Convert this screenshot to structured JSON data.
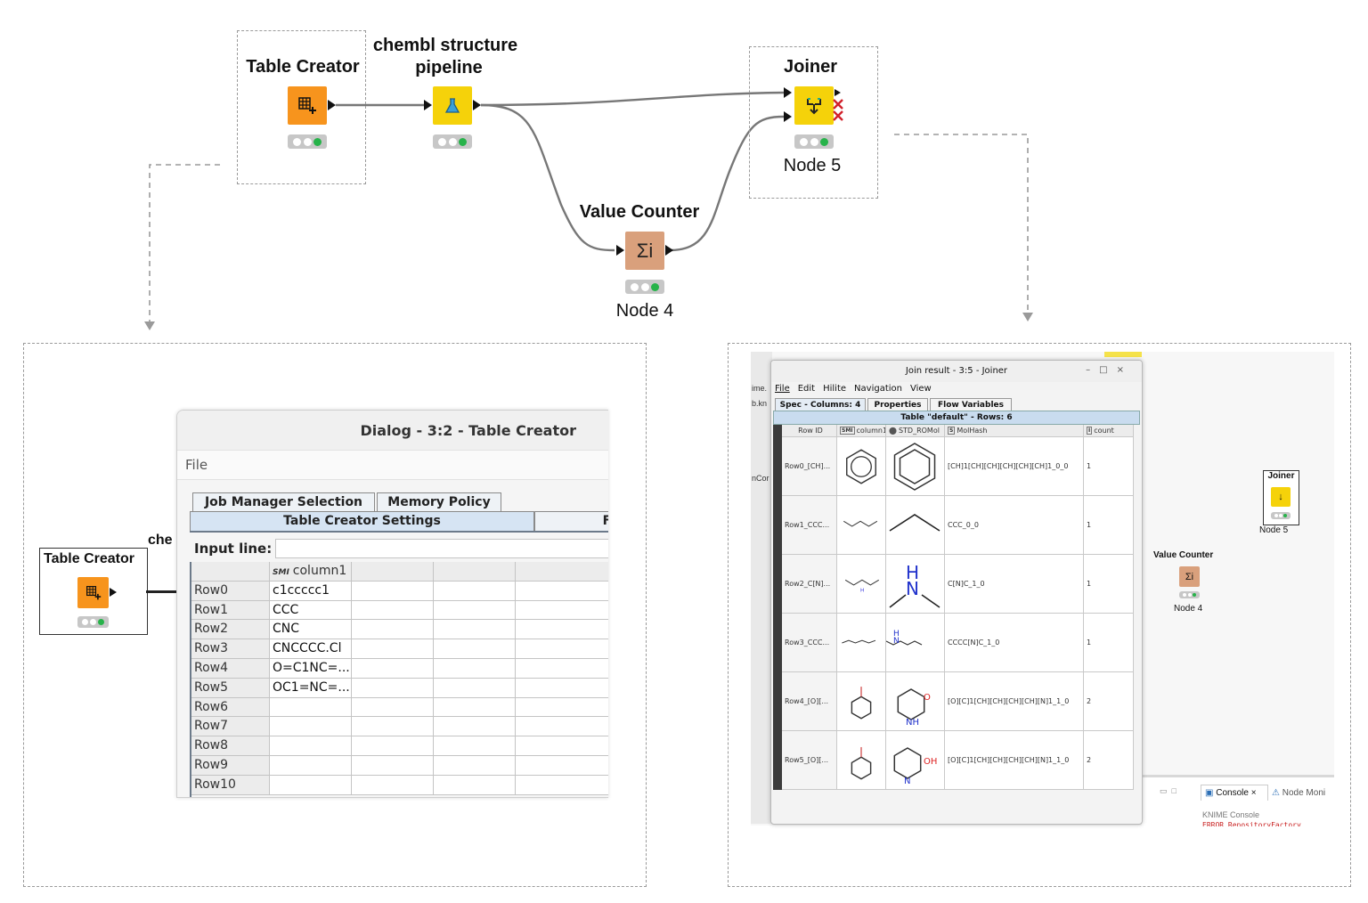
{
  "workflow": {
    "nodes": {
      "table_creator": {
        "title": "Table Creator",
        "icon": "table-plus-icon",
        "color": "#f7941d"
      },
      "chembl": {
        "title_line1": "chembl structure",
        "title_line2": "pipeline",
        "icon": "flask-icon",
        "color": "#f5d20a"
      },
      "joiner": {
        "title": "Joiner",
        "label": "Node 5",
        "icon": "joiner-icon",
        "color": "#f5d20a"
      },
      "value_counter": {
        "title": "Value Counter",
        "label": "Node 4",
        "icon": "sigma-icon",
        "color": "#d9a07c"
      }
    }
  },
  "dialog_panel": {
    "node_title": "Table Creator",
    "partial_label": "che",
    "dialog": {
      "title": "Dialog - 3:2 - Table Creator",
      "menu": "File",
      "tabs": [
        "Job Manager Selection",
        "Memory Policy"
      ],
      "selected_tab": "Table Creator Settings",
      "partial_tab": "Fl",
      "input_label": "Input line:",
      "column_icon": "SMI",
      "column_header": "column1",
      "rows": [
        {
          "id": "Row0",
          "value": "c1ccccc1"
        },
        {
          "id": "Row1",
          "value": "CCC"
        },
        {
          "id": "Row2",
          "value": "CNC"
        },
        {
          "id": "Row3",
          "value": "CNCCCC.Cl"
        },
        {
          "id": "Row4",
          "value": "O=C1NC=..."
        },
        {
          "id": "Row5",
          "value": "OC1=NC=..."
        },
        {
          "id": "Row6",
          "value": ""
        },
        {
          "id": "Row7",
          "value": ""
        },
        {
          "id": "Row8",
          "value": ""
        },
        {
          "id": "Row9",
          "value": ""
        },
        {
          "id": "Row10",
          "value": ""
        }
      ]
    }
  },
  "result_panel": {
    "window_title": "Join result - 3:5 - Joiner",
    "menu": [
      "File",
      "Edit",
      "Hilite",
      "Navigation",
      "View"
    ],
    "bg_partial_labels": [
      "ime.",
      "b.kn",
      "nCor"
    ],
    "tabs": [
      "Spec - Columns: 4",
      "Properties",
      "Flow Variables"
    ],
    "table_caption": "Table \"default\" - Rows: 6",
    "headers": [
      "Row ID",
      "column1",
      "STD_ROMol",
      "MolHash",
      "count"
    ],
    "header_icons": [
      "SMI",
      "mol-icon",
      "S",
      "I"
    ],
    "rows": [
      {
        "id": "Row0_[CH]...",
        "hash": "[CH]1[CH][CH][CH][CH][CH]1_0_0",
        "count": "1"
      },
      {
        "id": "Row1_CCC...",
        "hash": "CCC_0_0",
        "count": "1"
      },
      {
        "id": "Row2_C[N]...",
        "hash": "C[N]C_1_0",
        "count": "1"
      },
      {
        "id": "Row3_CCC...",
        "hash": "CCCC[N]C_1_0",
        "count": "1"
      },
      {
        "id": "Row4_[O][...",
        "hash": "[O][C]1[CH][CH][CH][CH][N]1_1_0",
        "count": "2"
      },
      {
        "id": "Row5_[O][...",
        "hash": "[O][C]1[CH][CH][CH][CH][N]1_1_0",
        "count": "2"
      }
    ],
    "mini_nodes": {
      "joiner": "Joiner",
      "joiner_label": "Node 5",
      "value_counter": "Value Counter",
      "vc_label": "Node 4"
    },
    "console_tab": "Console",
    "node_monitor_tab": "Node Moni",
    "console_title": "KNIME Console",
    "console_error": "ERROR RepositoryFactory"
  }
}
